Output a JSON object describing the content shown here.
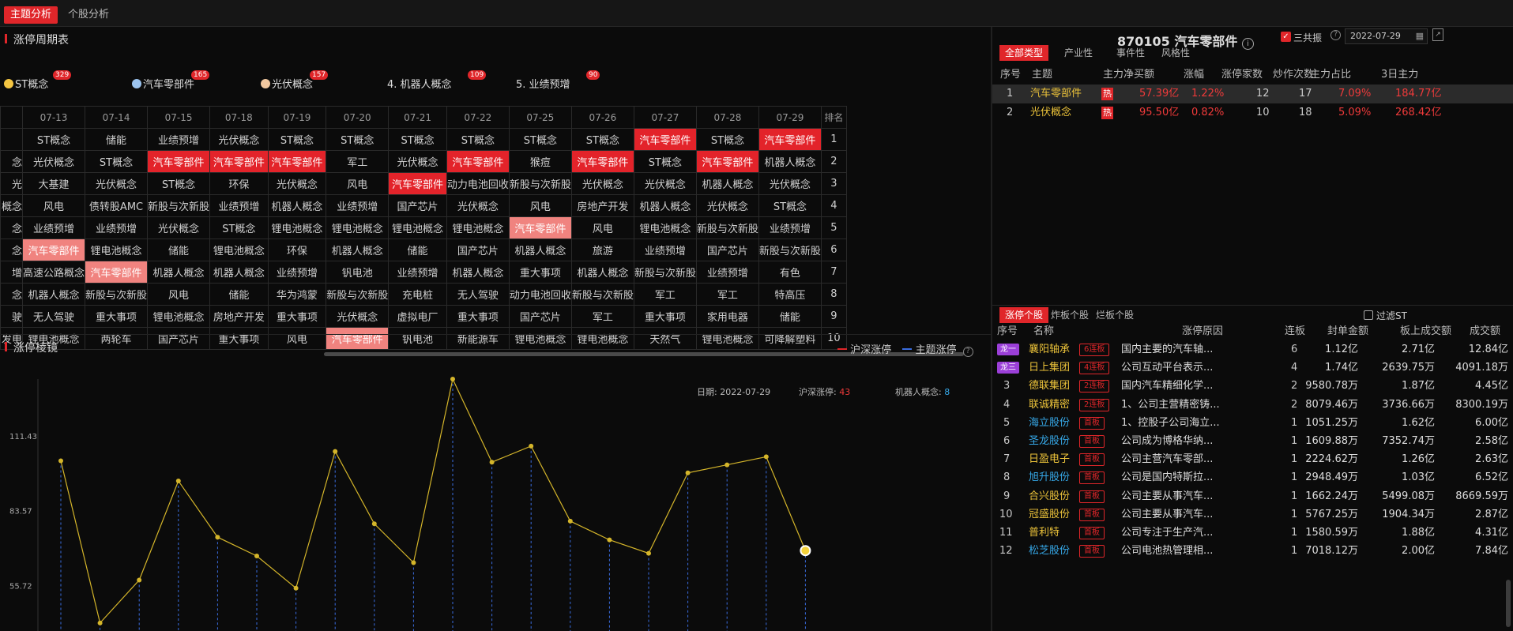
{
  "top_tabs": [
    "主题分析",
    "个股分析"
  ],
  "limit_cycle": {
    "title": "涨停周期表",
    "themes": [
      {
        "icon": "coin-icon",
        "color": "#f4c542",
        "name": "ST概念",
        "count": "329"
      },
      {
        "icon": "cube-icon",
        "color": "#9cc4f0",
        "name": "汽车零部件",
        "count": "165"
      },
      {
        "icon": "cube-icon",
        "color": "#f3c9a0",
        "name": "光伏概念",
        "count": "157"
      },
      {
        "icon": "",
        "color": "",
        "name": "4. 机器人概念",
        "count": "109"
      },
      {
        "icon": "",
        "color": "",
        "name": "5. 业绩预增",
        "count": "90"
      }
    ],
    "dates": [
      "07-13",
      "07-14",
      "07-15",
      "07-18",
      "07-19",
      "07-20",
      "07-21",
      "07-22",
      "07-25",
      "07-26",
      "07-27",
      "07-28",
      "07-29"
    ],
    "rank_header": "排名",
    "left_fragments": [
      "念",
      "光",
      "概念",
      "念",
      "念",
      "增",
      "念",
      "驶",
      "发电"
    ],
    "rows": [
      [
        "ST概念",
        "储能",
        "业绩预增",
        "光伏概念",
        "ST概念",
        "ST概念",
        "ST概念",
        "ST概念",
        "ST概念",
        "ST概念",
        "汽车零部件",
        "ST概念",
        "汽车零部件"
      ],
      [
        "光伏概念",
        "ST概念",
        "汽车零部件",
        "汽车零部件",
        "汽车零部件",
        "军工",
        "光伏概念",
        "汽车零部件",
        "猴痘",
        "汽车零部件",
        "ST概念",
        "汽车零部件",
        "机器人概念"
      ],
      [
        "大基建",
        "光伏概念",
        "ST概念",
        "环保",
        "光伏概念",
        "风电",
        "汽车零部件",
        "动力电池回收",
        "新股与次新股",
        "光伏概念",
        "光伏概念",
        "机器人概念",
        "光伏概念"
      ],
      [
        "风电",
        "债转股AMC",
        "新股与次新股",
        "业绩预增",
        "机器人概念",
        "业绩预增",
        "国产芯片",
        "光伏概念",
        "风电",
        "房地产开发",
        "机器人概念",
        "光伏概念",
        "ST概念"
      ],
      [
        "业绩预增",
        "业绩预增",
        "光伏概念",
        "ST概念",
        "锂电池概念",
        "锂电池概念",
        "锂电池概念",
        "锂电池概念",
        "汽车零部件",
        "风电",
        "锂电池概念",
        "新股与次新股",
        "业绩预增"
      ],
      [
        "汽车零部件",
        "锂电池概念",
        "储能",
        "锂电池概念",
        "环保",
        "机器人概念",
        "储能",
        "国产芯片",
        "机器人概念",
        "旅游",
        "业绩预增",
        "国产芯片",
        "新股与次新股"
      ],
      [
        "高速公路概念",
        "汽车零部件",
        "机器人概念",
        "机器人概念",
        "业绩预增",
        "钒电池",
        "业绩预增",
        "机器人概念",
        "重大事项",
        "机器人概念",
        "新股与次新股",
        "业绩预增",
        "有色"
      ],
      [
        "机器人概念",
        "新股与次新股",
        "风电",
        "储能",
        "华为鸿蒙",
        "新股与次新股",
        "充电桩",
        "无人驾驶",
        "动力电池回收",
        "新股与次新股",
        "军工",
        "军工",
        "特高压"
      ],
      [
        "无人驾驶",
        "重大事项",
        "锂电池概念",
        "房地产开发",
        "重大事项",
        "光伏概念",
        "虚拟电厂",
        "重大事项",
        "国产芯片",
        "军工",
        "重大事项",
        "家用电器",
        "储能"
      ],
      [
        "锂电池概念",
        "两轮车",
        "国产芯片",
        "重大事项",
        "风电",
        "汽车零部件",
        "钒电池",
        "新能源车",
        "锂电池概念",
        "锂电池概念",
        "天然气",
        "锂电池概念",
        "可降解塑料"
      ]
    ]
  },
  "mirror": {
    "title": "涨停棱镜",
    "legend": [
      {
        "name": "沪深涨停",
        "color": "#e0262a"
      },
      {
        "name": "主题涨停",
        "color": "#3a6de0"
      }
    ],
    "info": {
      "date_label": "日期:",
      "date": "2022-07-29",
      "sh_label": "沪深涨停:",
      "sh_val": "43",
      "theme_label": "机器人概念:",
      "theme_val": "8"
    }
  },
  "chart_data": {
    "type": "line",
    "y_ticks": [
      "111.43",
      "83.57",
      "55.72"
    ],
    "ylim": [
      39,
      133
    ],
    "values": [
      102.5,
      42,
      58,
      95,
      74,
      67,
      55,
      106,
      79,
      64.5,
      133,
      102,
      108,
      80,
      73,
      68,
      98,
      101,
      104,
      69
    ],
    "highlight_last": true,
    "line_color": "#d4b52a"
  },
  "detail": {
    "code": "870105",
    "name": "汽车零部件",
    "san_gong_zhen": "三共振",
    "date": "2022-07-29",
    "type_tabs": [
      "全部类型",
      "产业性",
      "事件性",
      "风格性"
    ],
    "headers": [
      "序号",
      "主题",
      "主力净买额",
      "涨幅",
      "涨停家数",
      "炒作次数",
      "主力占比",
      "3日主力"
    ],
    "rows": [
      {
        "no": "1",
        "name": "汽车零部件",
        "hot": "热",
        "net": "57.39亿",
        "chg": "1.22%",
        "zt": "12",
        "times": "17",
        "ratio": "7.09%",
        "d3": "184.77亿"
      },
      {
        "no": "2",
        "name": "光伏概念",
        "hot": "热",
        "net": "95.50亿",
        "chg": "0.82%",
        "zt": "10",
        "times": "18",
        "ratio": "5.09%",
        "d3": "268.42亿"
      }
    ]
  },
  "stocks": {
    "tabs": [
      "涨停个股",
      "炸板个股",
      "烂板个股"
    ],
    "filter_label": "过滤ST",
    "headers": [
      "序号",
      "名称",
      "涨停原因",
      "连板",
      "封单金额",
      "板上成交额",
      "成交额"
    ],
    "rows": [
      {
        "no": "龙一",
        "name": "襄阳轴承",
        "nc": "yel",
        "lb": "6连板",
        "reason": "国内主要的汽车轴...",
        "n": "6",
        "seal": "1.12亿",
        "onboard": "2.71亿",
        "amount": "12.84亿",
        "dragon": true
      },
      {
        "no": "龙三",
        "name": "日上集团",
        "nc": "yel",
        "lb": "4连板",
        "reason": "公司互动平台表示...",
        "n": "4",
        "seal": "1.74亿",
        "onboard": "2639.75万",
        "amount": "4091.18万",
        "dragon": true
      },
      {
        "no": "3",
        "name": "德联集团",
        "nc": "yel",
        "lb": "2连板",
        "reason": "国内汽车精细化学...",
        "n": "2",
        "seal": "9580.78万",
        "onboard": "1.87亿",
        "amount": "4.45亿"
      },
      {
        "no": "4",
        "name": "联诚精密",
        "nc": "yel",
        "lb": "2连板",
        "reason": "1、公司主营精密铸...",
        "n": "2",
        "seal": "8079.46万",
        "onboard": "3736.66万",
        "amount": "8300.19万"
      },
      {
        "no": "5",
        "name": "海立股份",
        "nc": "blu",
        "lb": "首板",
        "reason": "1、控股子公司海立...",
        "n": "1",
        "seal": "1051.25万",
        "onboard": "1.62亿",
        "amount": "6.00亿"
      },
      {
        "no": "6",
        "name": "圣龙股份",
        "nc": "blu",
        "lb": "首板",
        "reason": "公司成为博格华纳...",
        "n": "1",
        "seal": "1609.88万",
        "onboard": "7352.74万",
        "amount": "2.58亿"
      },
      {
        "no": "7",
        "name": "日盈电子",
        "nc": "yel",
        "lb": "首板",
        "reason": "公司主营汽车零部...",
        "n": "1",
        "seal": "2224.62万",
        "onboard": "1.26亿",
        "amount": "2.63亿"
      },
      {
        "no": "8",
        "name": "旭升股份",
        "nc": "blu",
        "lb": "首板",
        "reason": "公司是国内特斯拉...",
        "n": "1",
        "seal": "2948.49万",
        "onboard": "1.03亿",
        "amount": "6.52亿"
      },
      {
        "no": "9",
        "name": "合兴股份",
        "nc": "yel",
        "lb": "首板",
        "reason": "公司主要从事汽车...",
        "n": "1",
        "seal": "1662.24万",
        "onboard": "5499.08万",
        "amount": "8669.59万"
      },
      {
        "no": "10",
        "name": "冠盛股份",
        "nc": "yel",
        "lb": "首板",
        "reason": "公司主要从事汽车...",
        "n": "1",
        "seal": "5767.25万",
        "onboard": "1904.34万",
        "amount": "2.87亿"
      },
      {
        "no": "11",
        "name": "普利特",
        "nc": "yel",
        "lb": "首板",
        "reason": "公司专注于生产汽...",
        "n": "1",
        "seal": "1580.59万",
        "onboard": "1.88亿",
        "amount": "4.31亿"
      },
      {
        "no": "12",
        "name": "松芝股份",
        "nc": "blu",
        "lb": "首板",
        "reason": "公司电池热管理相...",
        "n": "1",
        "seal": "7018.12万",
        "onboard": "2.00亿",
        "amount": "7.84亿"
      }
    ]
  }
}
